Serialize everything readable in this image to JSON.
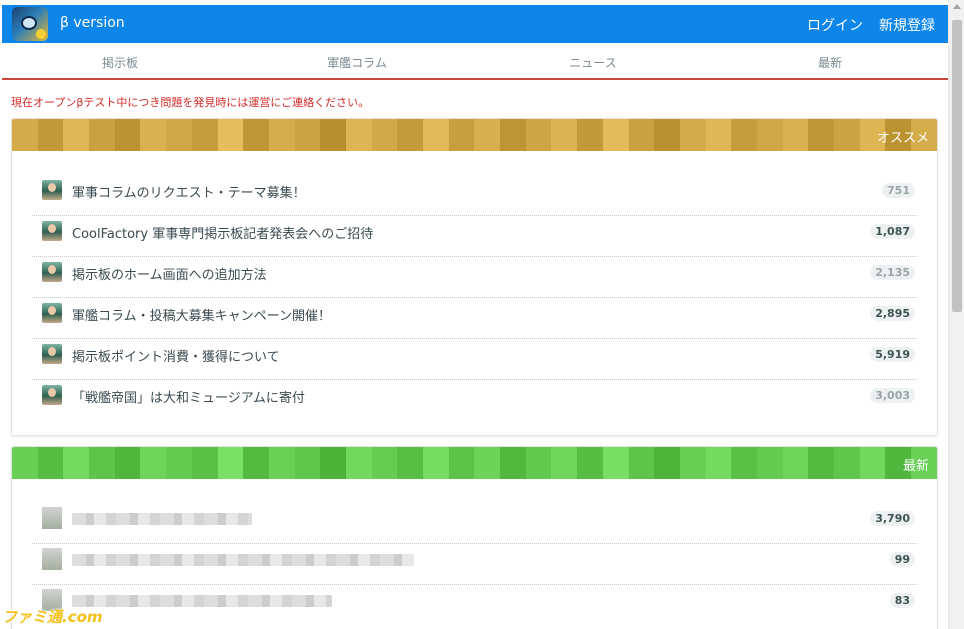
{
  "header": {
    "version": "β version",
    "login": "ログイン",
    "register": "新規登録"
  },
  "nav": [
    {
      "label": "掲示板"
    },
    {
      "label": "軍艦コラム"
    },
    {
      "label": "ニュース"
    },
    {
      "label": "最新"
    }
  ],
  "notice": "現在オープンβテスト中につき問題を発見時には運営にご連絡ください。",
  "recommended": {
    "title": "オススメ",
    "color": "#c9a13f",
    "items": [
      {
        "text": "軍事コラムのリクエスト・テーマ募集！",
        "count": "751",
        "tone": "light"
      },
      {
        "text": "CoolFactory 軍事専門掲示板記者発表会へのご招待",
        "count": "1,087",
        "tone": "dark"
      },
      {
        "text": "掲示板のホーム画面への追加方法",
        "count": "2,135",
        "tone": "light"
      },
      {
        "text": "軍艦コラム・投稿大募集キャンペーン開催！",
        "count": "2,895",
        "tone": "dark"
      },
      {
        "text": "掲示板ポイント消費・獲得について",
        "count": "5,919",
        "tone": "dark"
      },
      {
        "text": "「戦艦帝国」は大和ミュージアムに寄付",
        "count": "3,003",
        "tone": "light"
      }
    ]
  },
  "latest": {
    "title": "最新",
    "color": "#5cc54a",
    "items": [
      {
        "count": "3,790",
        "tone": "dark"
      },
      {
        "count": "99",
        "tone": "dark"
      },
      {
        "count": "83",
        "tone": "dark"
      }
    ]
  },
  "watermark": "ファミ通.com"
}
